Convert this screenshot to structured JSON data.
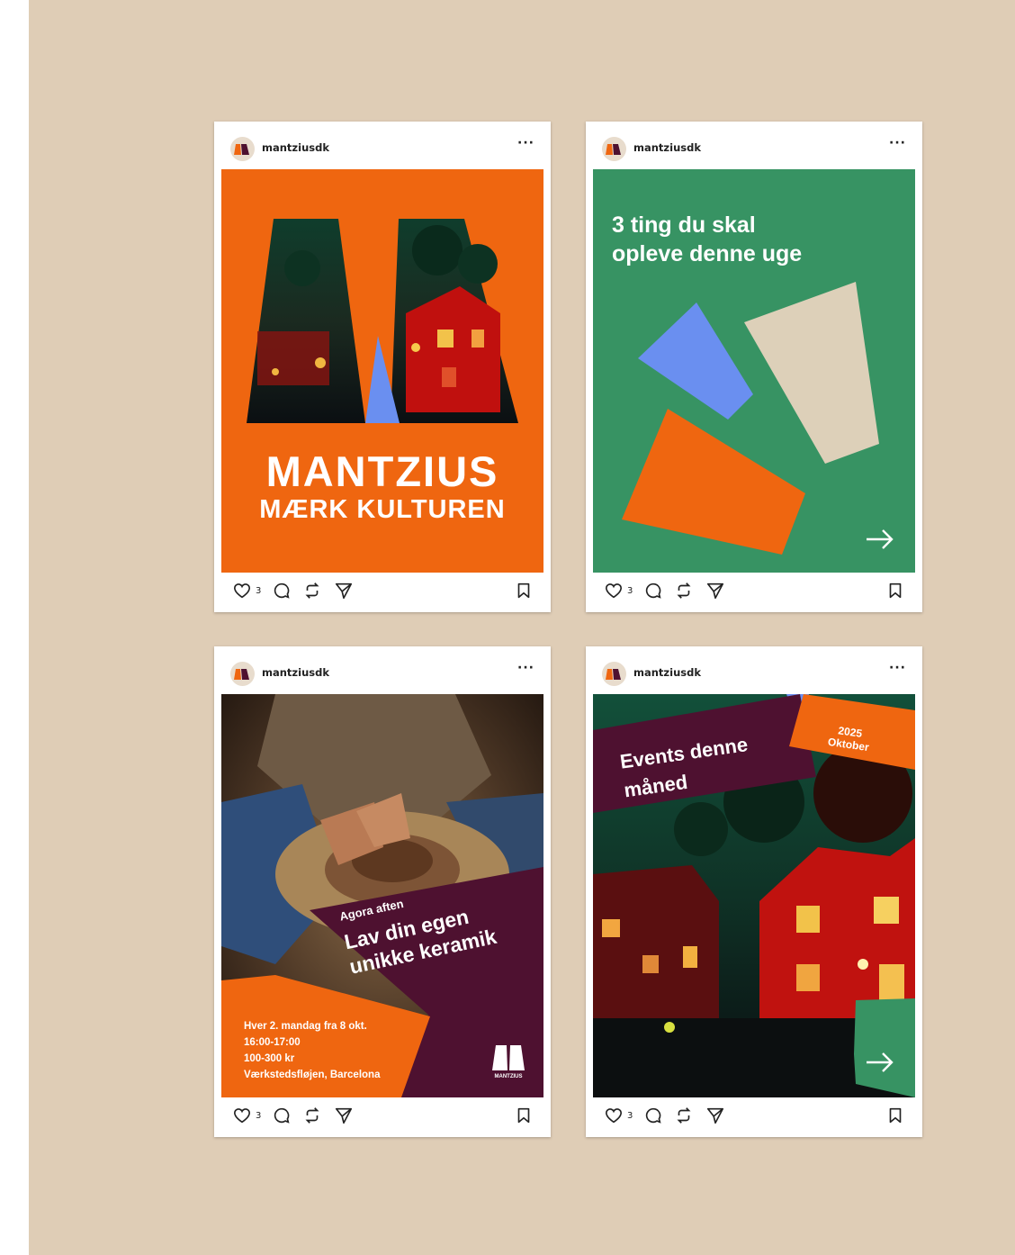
{
  "username": "mantziusdk",
  "more_label": "···",
  "colors": {
    "background": "#dfcdb6",
    "orange": "#ef6610",
    "green": "#379363",
    "blue": "#6a8ff0",
    "beige": "#ddd0b9",
    "plum": "#4e1130"
  },
  "icons": [
    "heart-icon",
    "comment-icon",
    "repost-icon",
    "send-icon",
    "bookmark-icon",
    "right-arrow-icon"
  ],
  "posts": [
    {
      "likes": "3",
      "title_line1": "MANTZIUS",
      "title_line2": "MÆRK KULTUREN"
    },
    {
      "likes": "3",
      "heading_line1": "3 ting du skal",
      "heading_line2": "opleve denne uge"
    },
    {
      "likes": "3",
      "kicker": "Agora aften",
      "heading_line1": "Lav din egen",
      "heading_line2": "unikke keramik",
      "details": [
        "Hver 2. mandag fra 8 okt.",
        "16:00-17:00",
        "100-300 kr",
        "Værkstedsfløjen, Barcelona"
      ],
      "logo_text": "MANTZIUS"
    },
    {
      "likes": "3",
      "heading_line1": "Events denne",
      "heading_line2": "måned",
      "year": "2025",
      "month": "Oktober"
    }
  ]
}
